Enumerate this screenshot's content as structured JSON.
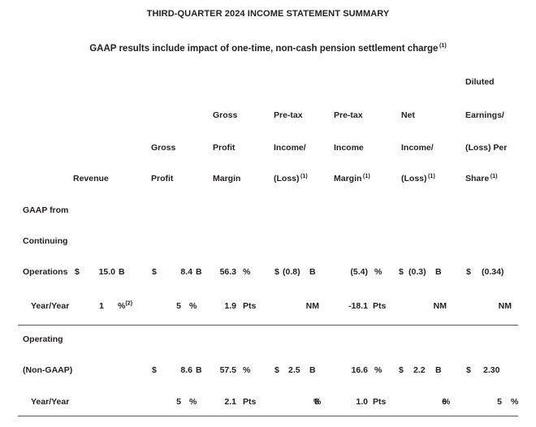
{
  "document": {
    "title": "THIRD-QUARTER 2024 INCOME STATEMENT SUMMARY",
    "subtitle_text": "GAAP results include impact of one-time, non-cash pension settlement charge",
    "subtitle_footnote": "(1)"
  },
  "table": {
    "column_headers": [
      {
        "id": "revenue",
        "lines": [
          "",
          "",
          "",
          "Revenue"
        ],
        "footnote": ""
      },
      {
        "id": "gross-profit",
        "lines": [
          "",
          "",
          "Gross",
          "Profit"
        ],
        "footnote": ""
      },
      {
        "id": "gross-margin",
        "lines": [
          "",
          "Gross",
          "Profit",
          "Margin"
        ],
        "footnote": ""
      },
      {
        "id": "pretax-income",
        "lines": [
          "",
          "Pre-tax",
          "Income/",
          "(Loss)"
        ],
        "footnote": "(1)"
      },
      {
        "id": "pretax-margin",
        "lines": [
          "",
          "Pre-tax",
          "Income",
          "Margin"
        ],
        "footnote": "(1)"
      },
      {
        "id": "net-income",
        "lines": [
          "",
          "Net",
          "Income/",
          "(Loss)"
        ],
        "footnote": "(1)"
      },
      {
        "id": "diluted-eps",
        "lines": [
          "Diluted",
          "Earnings/",
          "(Loss) Per",
          "Share"
        ],
        "footnote": "(1)"
      }
    ],
    "sections": [
      {
        "id": "gaap",
        "label_lines": [
          "GAAP from",
          "Continuing",
          "Operations"
        ],
        "rows": [
          {
            "id": "gaap-values",
            "label": "Operations",
            "cells": [
              {
                "currency": "$",
                "value": "15.0",
                "unit": "B",
                "footnote": ""
              },
              {
                "currency": "$",
                "value": "8.4",
                "unit": "B",
                "footnote": ""
              },
              {
                "currency": "",
                "value": "56.3",
                "unit": "%",
                "footnote": ""
              },
              {
                "currency": "$",
                "value": "(0.8)",
                "unit": "B",
                "footnote": ""
              },
              {
                "currency": "",
                "value": "(5.4)",
                "unit": "%",
                "footnote": ""
              },
              {
                "currency": "$",
                "value": "(0.3)",
                "unit": "B",
                "footnote": ""
              },
              {
                "currency": "$",
                "value": "(0.34)",
                "unit": "",
                "footnote": ""
              }
            ]
          },
          {
            "id": "gaap-yoy",
            "label": "Year/Year",
            "cells": [
              {
                "currency": "",
                "value": "1",
                "unit": "%",
                "footnote": "(2)"
              },
              {
                "currency": "",
                "value": "5",
                "unit": "%",
                "footnote": ""
              },
              {
                "currency": "",
                "value": "1.9",
                "unit": "Pts",
                "footnote": ""
              },
              {
                "currency": "",
                "value": "NM",
                "unit": "",
                "footnote": ""
              },
              {
                "currency": "",
                "value": "-18.1",
                "unit": "Pts",
                "footnote": ""
              },
              {
                "currency": "",
                "value": "NM",
                "unit": "",
                "footnote": ""
              },
              {
                "currency": "",
                "value": "NM",
                "unit": "",
                "footnote": ""
              }
            ]
          }
        ]
      },
      {
        "id": "operating-non-gaap",
        "label_lines": [
          "Operating",
          "(Non-GAAP)"
        ],
        "rows": [
          {
            "id": "non-gaap-values",
            "label": "(Non-GAAP)",
            "cells": [
              {
                "currency": "",
                "value": "",
                "unit": "",
                "footnote": ""
              },
              {
                "currency": "$",
                "value": "8.6",
                "unit": "B",
                "footnote": ""
              },
              {
                "currency": "",
                "value": "57.5",
                "unit": "%",
                "footnote": ""
              },
              {
                "currency": "$",
                "value": "2.5",
                "unit": "B",
                "footnote": ""
              },
              {
                "currency": "",
                "value": "16.6",
                "unit": "%",
                "footnote": ""
              },
              {
                "currency": "$",
                "value": "2.2",
                "unit": "B",
                "footnote": ""
              },
              {
                "currency": "$",
                "value": "2.30",
                "unit": "",
                "footnote": ""
              }
            ]
          },
          {
            "id": "non-gaap-yoy",
            "label": "Year/Year",
            "cells": [
              {
                "currency": "",
                "value": "",
                "unit": "",
                "footnote": ""
              },
              {
                "currency": "",
                "value": "5",
                "unit": "%",
                "footnote": ""
              },
              {
                "currency": "",
                "value": "2.1",
                "unit": "Pts",
                "footnote": ""
              },
              {
                "currency": "",
                "value": "8",
                "unit": "%",
                "footnote": ""
              },
              {
                "currency": "",
                "value": "1.0",
                "unit": "Pts",
                "footnote": ""
              },
              {
                "currency": "",
                "value": "6",
                "unit": "%",
                "footnote": ""
              },
              {
                "currency": "",
                "value": "5",
                "unit": "%",
                "footnote": ""
              }
            ]
          }
        ]
      }
    ]
  }
}
